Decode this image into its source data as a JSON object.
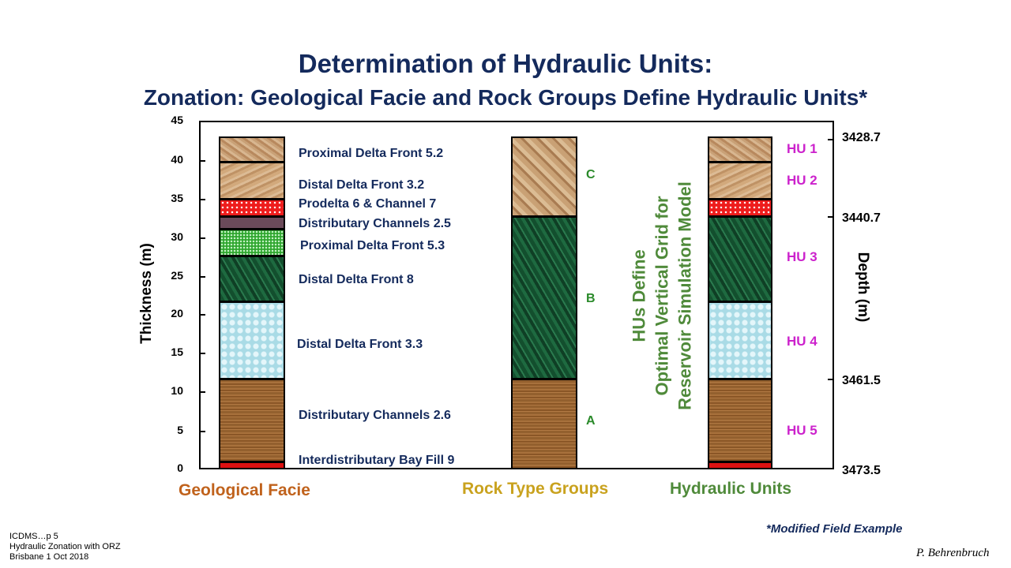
{
  "title": "Determination of Hydraulic Units:",
  "subtitle": "Zonation: Geological Facie and Rock Groups Define Hydraulic Units*",
  "left_axis": {
    "label": "Thickness (m)",
    "ticks": [
      "45",
      "40",
      "35",
      "30",
      "25",
      "20",
      "15",
      "10",
      "5",
      "0"
    ]
  },
  "right_axis": {
    "label": "Depth (m)",
    "ticks": [
      "3428.7",
      "3440.7",
      "3461.5",
      "3473.5"
    ]
  },
  "facies_labels": [
    "Proximal Delta Front 5.2",
    "Distal Delta Front 3.2",
    "Prodelta 6 &  Channel 7",
    "Distributary Channels 2.5",
    "Proximal Delta Front 5.3",
    "Distal Delta Front 8",
    "Distal Delta Front 3.3",
    "Distributary Channels 2.6",
    "Interdistributary Bay Fill 9"
  ],
  "rock_groups": [
    "C",
    "B",
    "A"
  ],
  "hydraulic_units": [
    "HU  1",
    "HU  2",
    "HU  3",
    "HU  4",
    "HU  5"
  ],
  "vertical_note": {
    "line1": "HUs Define",
    "line2": "Optimal Vertical Grid for",
    "line3": "Reservoir Simulation Model"
  },
  "column_titles": {
    "geological": "Geological Facie",
    "rock": "Rock Type Groups",
    "hydraulic": "Hydraulic Units"
  },
  "colors": {
    "geological": "#c0621c",
    "rock": "#c9a21e",
    "hydraulic": "#4f8a3a"
  },
  "footnote": "*Modified  Field  Example",
  "source_lines": [
    "ICDMS…p 5",
    "Hydraulic Zonation with ORZ",
    "Brisbane 1 Oct 2018"
  ],
  "signature": "P. Behrenbruch"
}
